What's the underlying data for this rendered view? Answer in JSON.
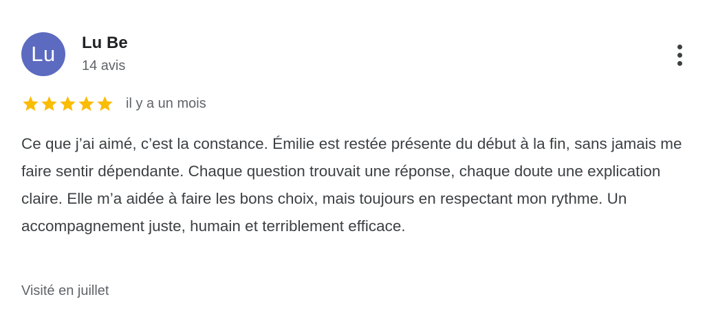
{
  "review": {
    "author": {
      "initials": "Lu",
      "name": "Lu Be",
      "review_count": "14 avis",
      "avatar_color": "#5c6bc0"
    },
    "more_icon": "more-vert-icon",
    "rating": {
      "stars": 5,
      "max": 5,
      "star_color": "#fbbc04"
    },
    "date": "il y a un mois",
    "text": "Ce que j’ai aimé, c’est la constance. Émilie est restée présente du début à la fin, sans jamais me faire sentir dépendante. Chaque question trouvait une réponse, chaque doute une explication claire. Elle m’a aidée à faire les bons choix, mais toujours en respectant mon rythme. Un accompagnement juste, humain et terriblement efficace.",
    "visited": "Visité en juillet"
  }
}
